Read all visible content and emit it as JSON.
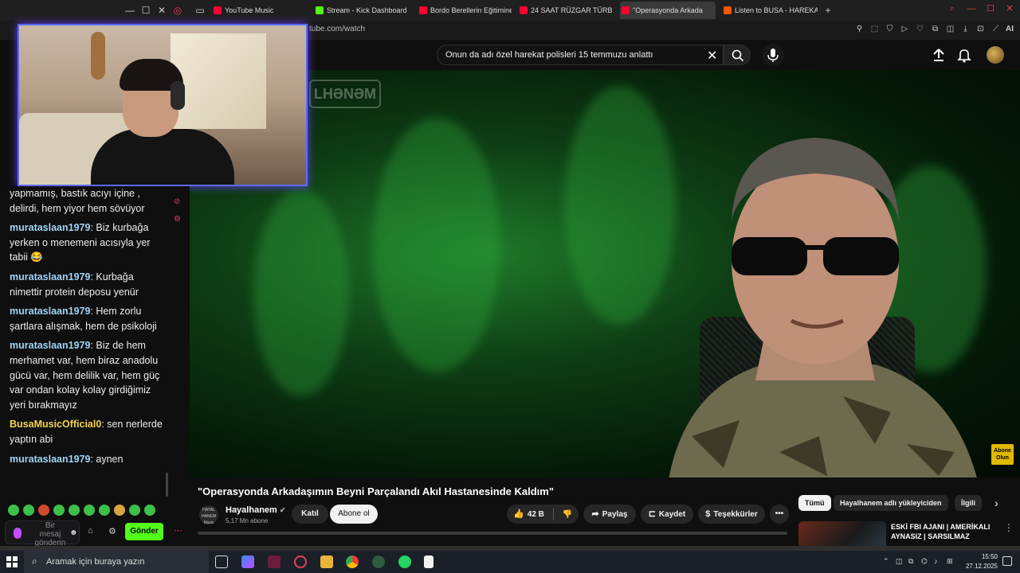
{
  "browser": {
    "tabs": [
      {
        "label": "YouTube Music",
        "color": "#ff0033"
      },
      {
        "label": "Stream - Kick Dashboard",
        "color": "#53fc18"
      },
      {
        "label": "Bordo Berellerin Eğitimine",
        "color": "#ff0033"
      },
      {
        "label": "24 SAAT RÜZGAR TÜRBİ",
        "color": "#ff0033"
      },
      {
        "label": "\"Operasyonda Arkada",
        "color": "#ff0033",
        "active": true
      },
      {
        "label": "Listen to BUSA - HAREKAT",
        "color": "#ff5500"
      }
    ],
    "url": "tube.com/watch",
    "ai_label": "AI"
  },
  "youtube": {
    "search_query": "Onun da adı özel harekat polisleri 15 temmuzu anlattı",
    "video_title": "\"Operasyonda Arkadaşımın Beyni Parçalandı Akıl Hastanesinde Kaldım\"",
    "watermark": "LHƏNƏM",
    "subscribe_badge": "Abone Olun",
    "channel": {
      "logo_text": "HAYAL HANEM Music",
      "name": "Hayalhanem",
      "subscribers": "5,17 Mn abone"
    },
    "buttons": {
      "join": "Katıl",
      "subscribe": "Abone ol",
      "likes": "42 B",
      "share": "Paylaş",
      "save": "Kaydet",
      "thanks": "Teşekkürler",
      "more": "•••"
    },
    "chips": {
      "all": "Tümü",
      "uploads": "Hayalhanem adlı yükleyiciden",
      "related": "İlgili"
    },
    "related_video": {
      "title": "ESKİ FBI AJANI | AMERİKALI AYNASIZ | SARSILMAZ"
    }
  },
  "chat": {
    "messages": [
      {
        "user": "",
        "text": "yapmamış, bastık acıyı içine , delirdi, hem yiyor hem sövüyor"
      },
      {
        "user": "murataslaan1979",
        "text": "Biz kurbağa yerken o menemeni acısıyla yer tabii 😂"
      },
      {
        "user": "murataslaan1979",
        "text": "Kurbağa nimettir protein deposu yenür"
      },
      {
        "user": "murataslaan1979",
        "text": "Hem zorlu şartlara alışmak, hem de psikoloji"
      },
      {
        "user": "murataslaan1979",
        "text": "Biz de hem merhamet var, hem biraz anadolu gücü var, hem delilik var, hem güç var ondan kolay kolay girdiğimiz yeri bırakmayız"
      },
      {
        "user": "BusaMusicOfficial0",
        "text": "sen nerlerde yaptın abi",
        "alt": true
      },
      {
        "user": "murataslaan1979",
        "text": "aynen"
      }
    ],
    "input_placeholder": "Bir mesaj gönderin",
    "send_label": "Gönder"
  },
  "taskbar": {
    "search_placeholder": "Aramak için buraya yazın",
    "time": "15:50",
    "date": "27.12.2025"
  }
}
